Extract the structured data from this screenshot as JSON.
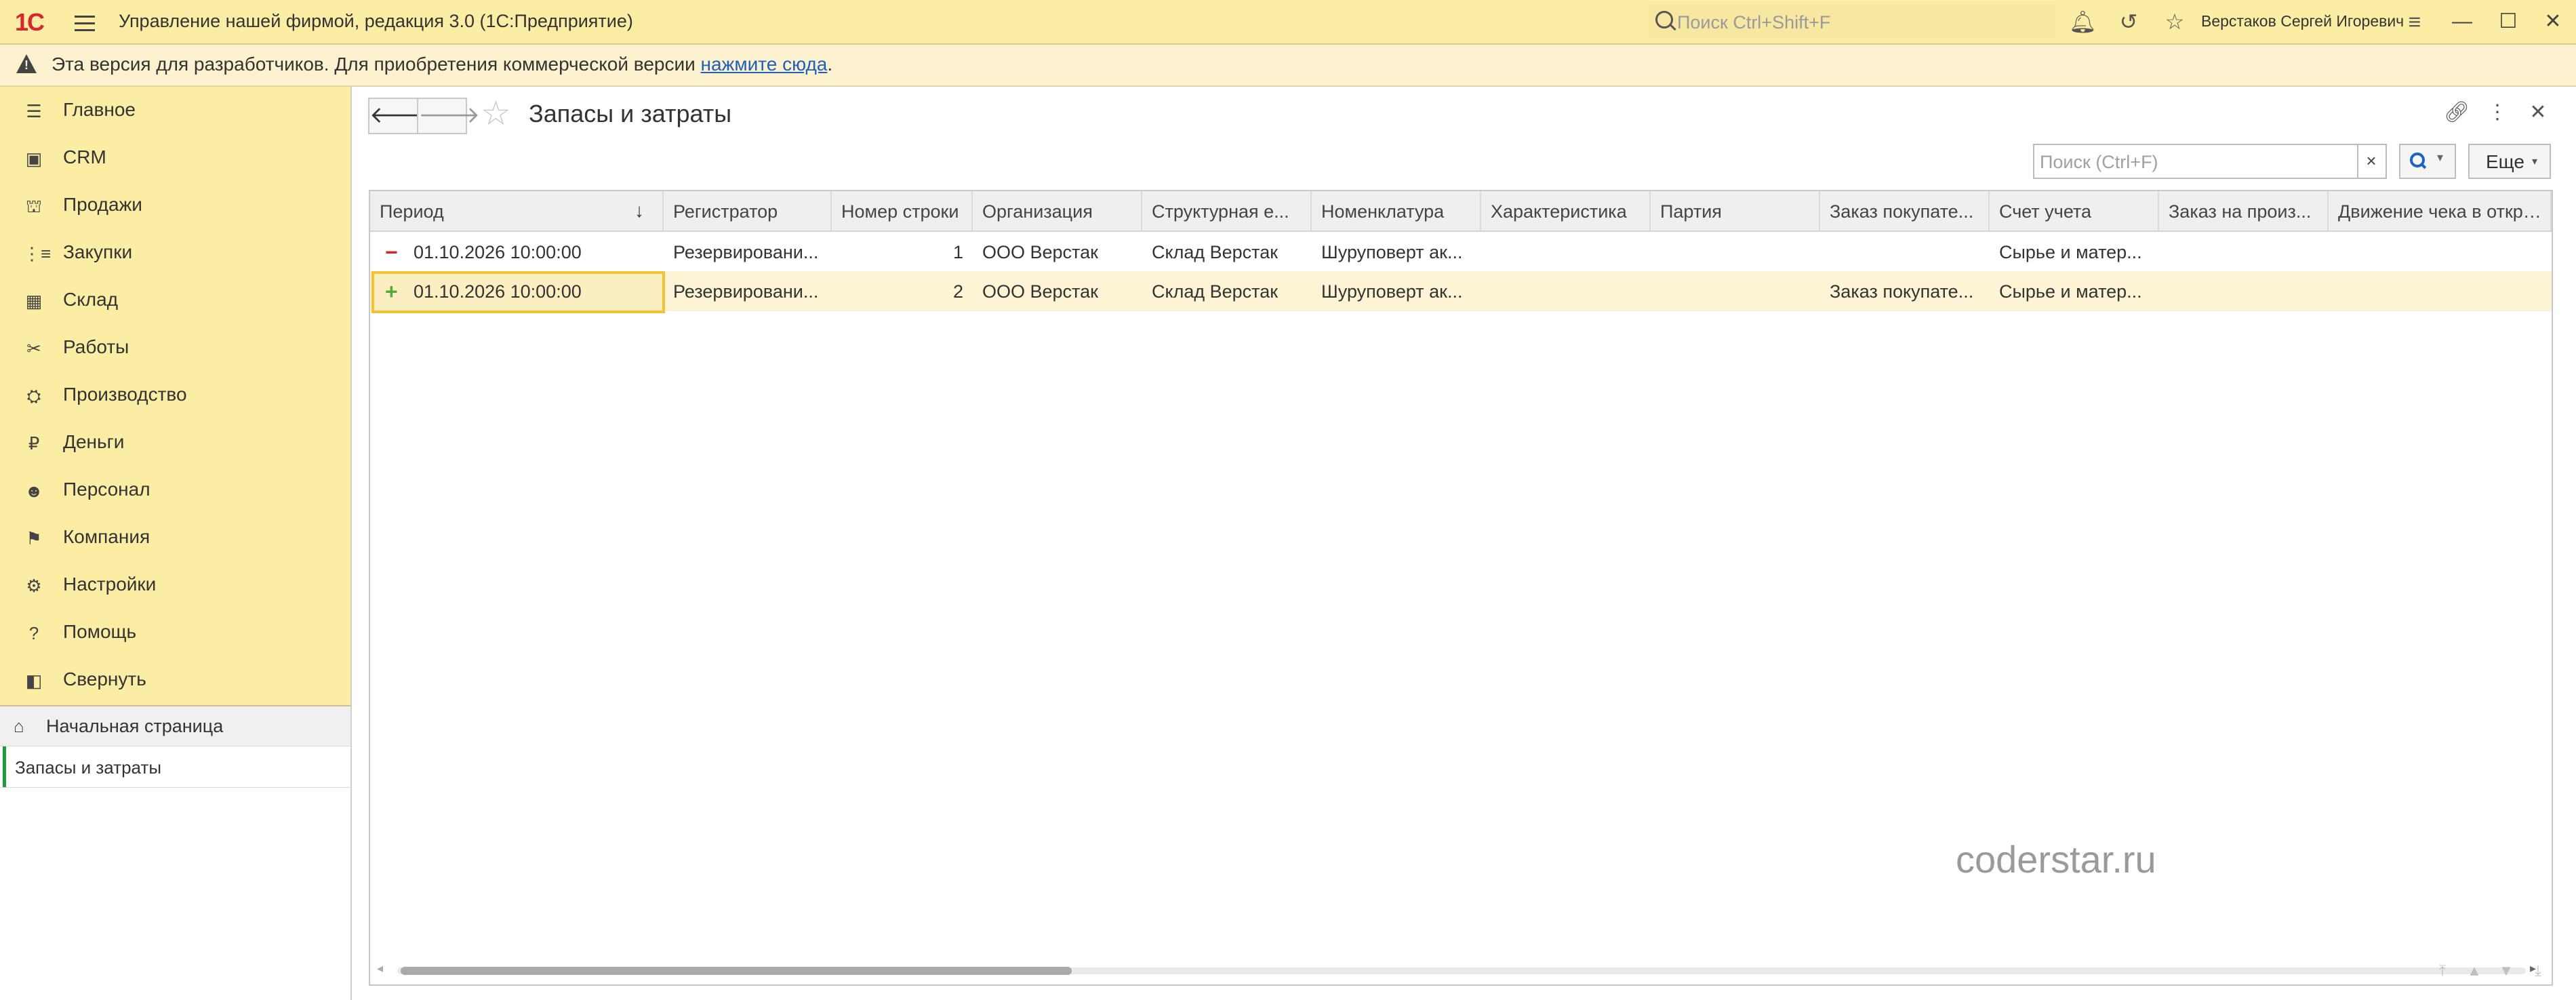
{
  "titlebar": {
    "logo_text": "1С",
    "app_title": "Управление нашей фирмой, редакция 3.0  (1С:Предприятие)",
    "search_placeholder": "Поиск Ctrl+Shift+F",
    "user_name": "Верстаков Сергей Игоревич",
    "icons": [
      "menu-icon",
      "bell-icon",
      "history-icon",
      "star-icon",
      "settings-lines-icon",
      "minimize-icon",
      "maximize-icon",
      "close-icon"
    ]
  },
  "warning": {
    "text": "Эта версия для разработчиков. Для приобретения коммерческой версии ",
    "link": "нажмите сюда",
    "tail": "."
  },
  "sidebar": {
    "items": [
      {
        "label": "Главное",
        "icon": "list-icon"
      },
      {
        "label": "CRM",
        "icon": "crm-icon"
      },
      {
        "label": "Продажи",
        "icon": "basket-icon"
      },
      {
        "label": "Закупки",
        "icon": "purchases-icon"
      },
      {
        "label": "Склад",
        "icon": "warehouse-icon"
      },
      {
        "label": "Работы",
        "icon": "tools-icon"
      },
      {
        "label": "Производство",
        "icon": "factory-icon"
      },
      {
        "label": "Деньги",
        "icon": "money-icon"
      },
      {
        "label": "Персонал",
        "icon": "people-icon"
      },
      {
        "label": "Компания",
        "icon": "flag-icon"
      },
      {
        "label": "Настройки",
        "icon": "gear-icon"
      },
      {
        "label": "Помощь",
        "icon": "help-icon"
      },
      {
        "label": "Свернуть",
        "icon": "collapse-icon"
      }
    ],
    "home_label": "Начальная страница",
    "open_tab_label": "Запасы и затраты"
  },
  "form": {
    "title": "Запасы и затраты",
    "search_placeholder": "Поиск (Ctrl+F)",
    "search_clear": "×",
    "more_label": "Еще",
    "columns": [
      "Период",
      "Регистратор",
      "Номер строки",
      "Организация",
      "Структурная е...",
      "Номенклатура",
      "Характеристика",
      "Партия",
      "Заказ покупате...",
      "Счет учета",
      "Заказ на произ...",
      "Движение чека в открыто"
    ],
    "rows": [
      {
        "sign": "−",
        "sign_color": "#d3272f",
        "cells": [
          "01.10.2026 10:00:00",
          "Резервировани...",
          "1",
          "ООО Верстак",
          "Склад Верстак",
          "Шуруповерт ак...",
          "",
          "",
          "",
          "Сырье и матер...",
          "",
          ""
        ]
      },
      {
        "sign": "+",
        "sign_color": "#58a83a",
        "cells": [
          "01.10.2026 10:00:00",
          "Резервировани...",
          "2",
          "ООО Верстак",
          "Склад Верстак",
          "Шуруповерт ак...",
          "",
          "",
          "Заказ покупате...",
          "Сырье и матер...",
          "",
          ""
        ]
      }
    ]
  },
  "watermark": "coderstar.ru"
}
